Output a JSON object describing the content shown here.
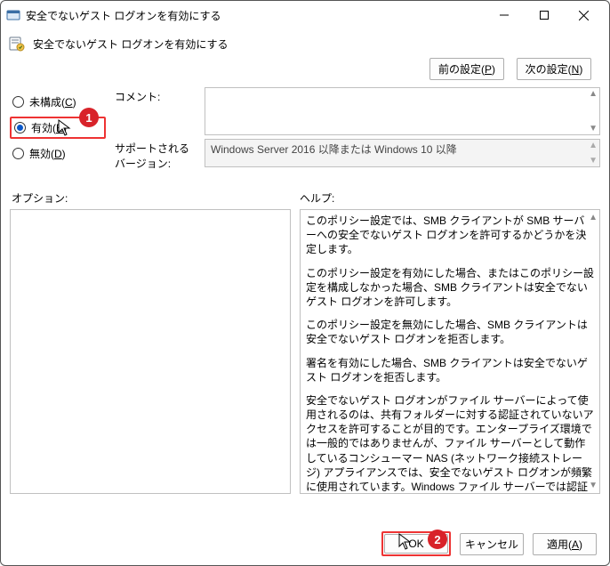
{
  "window": {
    "title": "安全でないゲスト ログオンを有効にする"
  },
  "header": {
    "title": "安全でないゲスト ログオンを有効にする",
    "prev_label_pre": "前の設定(",
    "prev_label_key": "P",
    "prev_label_post": ")",
    "next_label_pre": "次の設定(",
    "next_label_key": "N",
    "next_label_post": ")"
  },
  "radios": {
    "not_configured_pre": "未構成(",
    "not_configured_key": "C",
    "not_configured_post": ")",
    "enabled_pre": "有効(",
    "enabled_key": "E",
    "enabled_post": ")",
    "disabled_pre": "無効(",
    "disabled_key": "D",
    "disabled_post": ")"
  },
  "fields": {
    "comment_label": "コメント:",
    "supported_label": "サポートされるバージョン:",
    "supported_value": "Windows Server 2016 以降または Windows 10 以降"
  },
  "panes": {
    "options_label": "オプション:",
    "help_label": "ヘルプ:",
    "help_paragraphs": [
      "このポリシー設定では、SMB クライアントが SMB サーバーへの安全でないゲスト ログオンを許可するかどうかを決定します。",
      "このポリシー設定を有効にした場合、またはこのポリシー設定を構成しなかった場合、SMB クライアントは安全でないゲスト ログオンを許可します。",
      "このポリシー設定を無効にした場合、SMB クライアントは安全でないゲスト ログオンを拒否します。",
      "署名を有効にした場合、SMB クライアントは安全でないゲスト ログオンを拒否します。",
      "安全でないゲスト ログオンがファイル サーバーによって使用されるのは、共有フォルダーに対する認証されていないアクセスを許可することが目的です。エンタープライズ環境では一般的ではありませんが、ファイル サーバーとして動作しているコンシューマー NAS (ネットワーク接続ストレージ) アプライアンスでは、安全でないゲスト ログオンが頻繁に使用されています。Windows ファイル サーバーでは認証を要求し、既定では安全でないゲスト ログオンを使用しません。安全でないゲスト ログオンは認証されていないため、SMB 署名、SMB 暗号化などの重要なセキュリティ機能が無効になります。結果として、安全でないゲスト ログオンを許可するクライアントは、さまざまな"
    ]
  },
  "footer": {
    "ok_label": "OK",
    "cancel_label": "キャンセル",
    "apply_label_pre": "適用(",
    "apply_label_key": "A",
    "apply_label_post": ")"
  },
  "annotations": {
    "callout1": "1",
    "callout2": "2"
  }
}
